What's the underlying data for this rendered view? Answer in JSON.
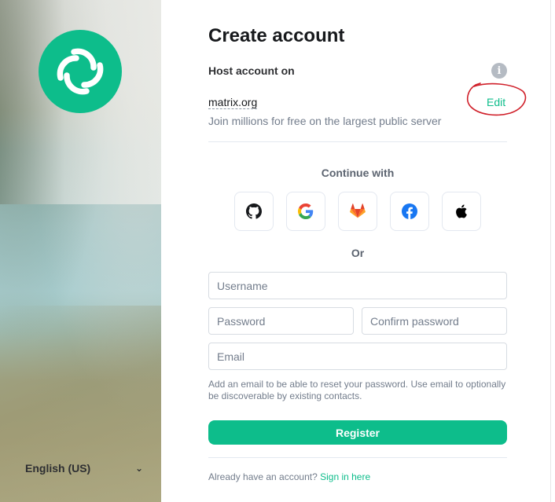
{
  "left_panel": {
    "logo_icon": "element-logo-icon",
    "language": "English (US)",
    "language_chevron_icon": "chevron-down-icon"
  },
  "form": {
    "title": "Create account",
    "host_label": "Host account on",
    "info_icon": "info-icon",
    "server_name": "matrix.org",
    "edit_label": "Edit",
    "server_description": "Join millions for free on the largest public server",
    "continue_with": "Continue with",
    "sso_providers": [
      "github-icon",
      "google-icon",
      "gitlab-icon",
      "facebook-icon",
      "apple-icon"
    ],
    "or_label": "Or",
    "username_placeholder": "Username",
    "password_placeholder": "Password",
    "confirm_password_placeholder": "Confirm password",
    "email_placeholder": "Email",
    "email_hint": "Add an email to be able to reset your password. Use email to optionally be discoverable by existing contacts.",
    "register_label": "Register",
    "already_have_account": "Already have an account?",
    "sign_in_label": "Sign in here"
  },
  "colors": {
    "accent": "#0dbd8b",
    "annotation": "#d0202a"
  }
}
